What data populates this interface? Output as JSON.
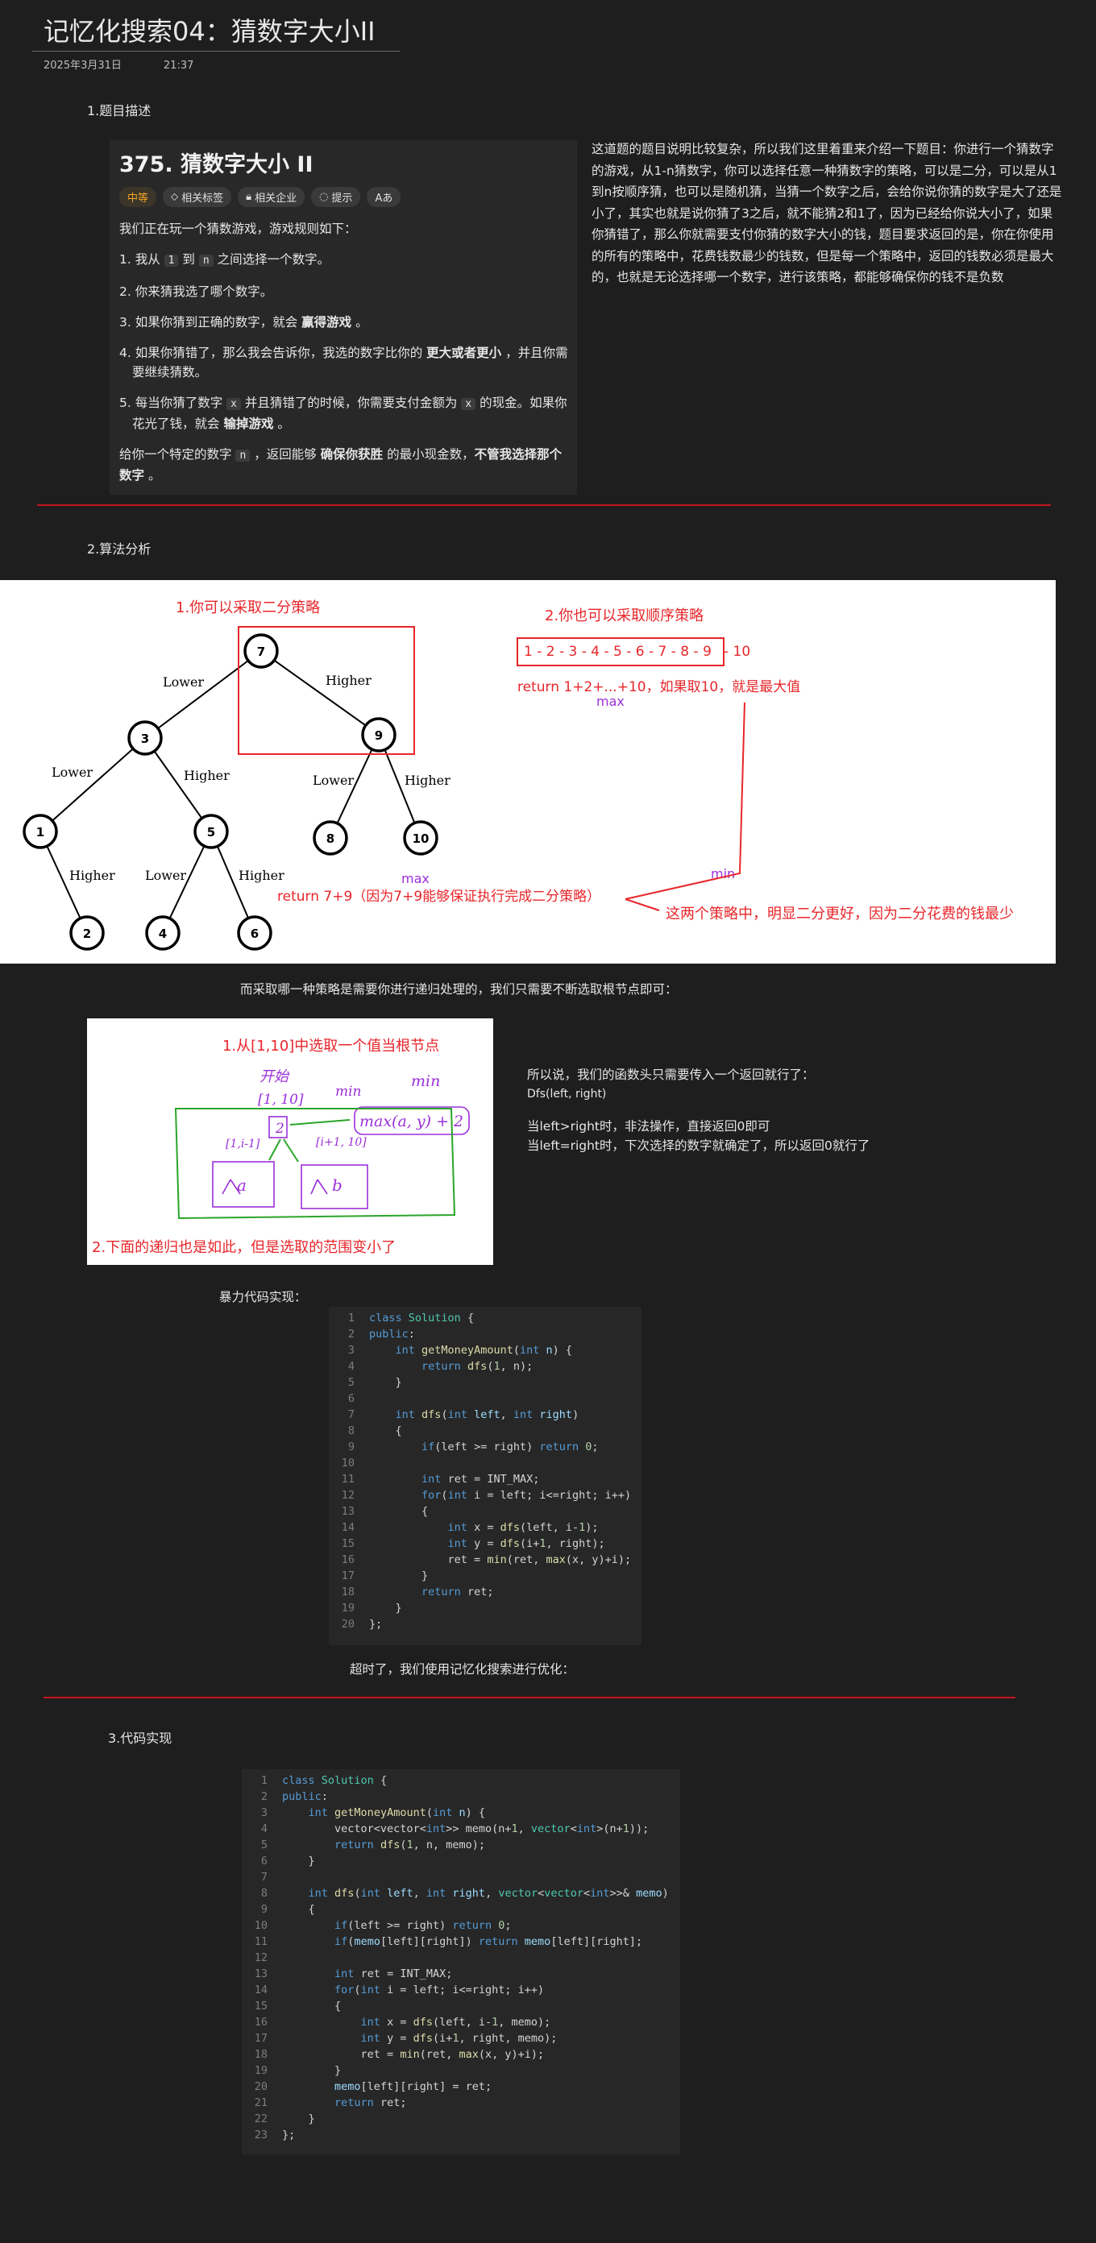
{
  "page": {
    "title": "记忆化搜索04：猜数字大小II",
    "date": "2025年3月31日",
    "time": "21:37"
  },
  "section1": {
    "heading": "1.题目描述"
  },
  "problem": {
    "title": "375. 猜数字大小 II",
    "tags": [
      {
        "label": "中等",
        "icon": ""
      },
      {
        "label": "相关标签",
        "icon": "tag-icon"
      },
      {
        "label": "相关企业",
        "icon": "lock-icon"
      },
      {
        "label": "提示",
        "icon": "bulb-icon"
      },
      {
        "label": "Aあ",
        "icon": "translate-icon"
      }
    ],
    "intro": "我们正在玩一个猜数游戏，游戏规则如下：",
    "rule1_a": "1. 我从 ",
    "rule1_c1": "1",
    "rule1_b": " 到 ",
    "rule1_c2": "n",
    "rule1_d": " 之间选择一个数字。",
    "rule2": "2. 你来猜我选了哪个数字。",
    "rule3_a": "3. 如果你猜到正确的数字，就会 ",
    "rule3_b": "赢得游戏",
    "rule3_c": " 。",
    "rule4_a": "4. 如果你猜错了，那么我会告诉你，我选的数字比你的 ",
    "rule4_b": "更大或者更小",
    "rule4_c": " ，并且你需要继续猜数。",
    "rule5_a": "5. 每当你猜了数字 ",
    "rule5_c1": "x",
    "rule5_b": " 并且猜错了的时候，你需要支付金额为 ",
    "rule5_c2": "x",
    "rule5_d": " 的现金。如果你花光了钱，就会 ",
    "rule5_e": "输掉游戏",
    "rule5_f": " 。",
    "final_a": "给你一个特定的数字 ",
    "final_c": "n",
    "final_b": " ，返回能够 ",
    "final_d": "确保你获胜",
    "final_e": " 的最小现金数，",
    "final_f": "不管我选择那个数字",
    "final_g": " 。"
  },
  "description": "这道题的题目说明比较复杂，所以我们这里着重来介绍一下题目：你进行一个猜数字的游戏，从1-n猜数字，你可以选择任意一种猜数字的策略，可以是二分，可以是从1到n按顺序猜，也可以是随机猜，当猜一个数字之后，会给你说你猜的数字是大了还是小了，其实也就是说你猜了3之后，就不能猜2和1了，因为已经给你说大小了，如果你猜错了，那么你就需要支付你猜的数字大小的钱，题目要求返回的是，你在你使用的所有的策略中，花费钱数最少的钱数，但是每一个策略中，返回的钱数必须是最大的，也就是无论选择哪一个数字，进行该策略，都能够确保你的钱不是负数",
  "section2": {
    "heading": "2.算法分析"
  },
  "tree": {
    "label_binary": "1.你可以采取二分策略",
    "label_seq": "2.你也可以采取顺序策略",
    "nodes": [
      "7",
      "3",
      "9",
      "1",
      "5",
      "8",
      "10",
      "2",
      "4",
      "6"
    ],
    "edge_lower": "Lower",
    "edge_higher": "Higher",
    "sequence": "1 - 2 - 3 - 4 - 5 - 6 - 7 - 8 - 9",
    "seq_last": "- 10",
    "seq_return": "return 1+2+...+10，如果取10，就是最大值",
    "max": "max",
    "min": "min",
    "bin_return": "return 7+9（因为7+9能够保证执行完成二分策略）",
    "conclusion": "这两个策略中，明显二分更好，因为二分花费的钱最少"
  },
  "para_root": "而采取哪一种策略是需要你进行递归处理的，我们只需要不断选取根节点即可：",
  "sketch": {
    "label1": "1.从[1,10]中选取一个值当根节点",
    "hw_start": "开始",
    "hw_range": "[1, 10]",
    "hw_min1": "min",
    "hw_min2": "min",
    "hw_max": "max(a, y) + 2",
    "hw_root": "2",
    "hw_left": "[1,i-1]",
    "hw_right": "[i+1, 10]",
    "hw_a": "a",
    "hw_b": "b",
    "label2": "2.下面的递归也是如此，但是选取的范围变小了"
  },
  "side_notes": {
    "line1": "所以说，我们的函数头只需要传入一个返回就行了：",
    "line2": "Dfs(left, right)",
    "line3": "当left>right时，非法操作，直接返回0即可",
    "line4": "当left=right时，下次选择的数字就确定了，所以返回0就行了"
  },
  "brute_label": "暴力代码实现：",
  "timeout_label": "超时了，我们使用记忆化搜索进行优化：",
  "section3": {
    "heading": "3.代码实现"
  },
  "colors": {
    "accent_red": "#e8262a",
    "rule_red": "#c4161c",
    "purple": "#9b30d9",
    "green": "#2aa52a"
  }
}
